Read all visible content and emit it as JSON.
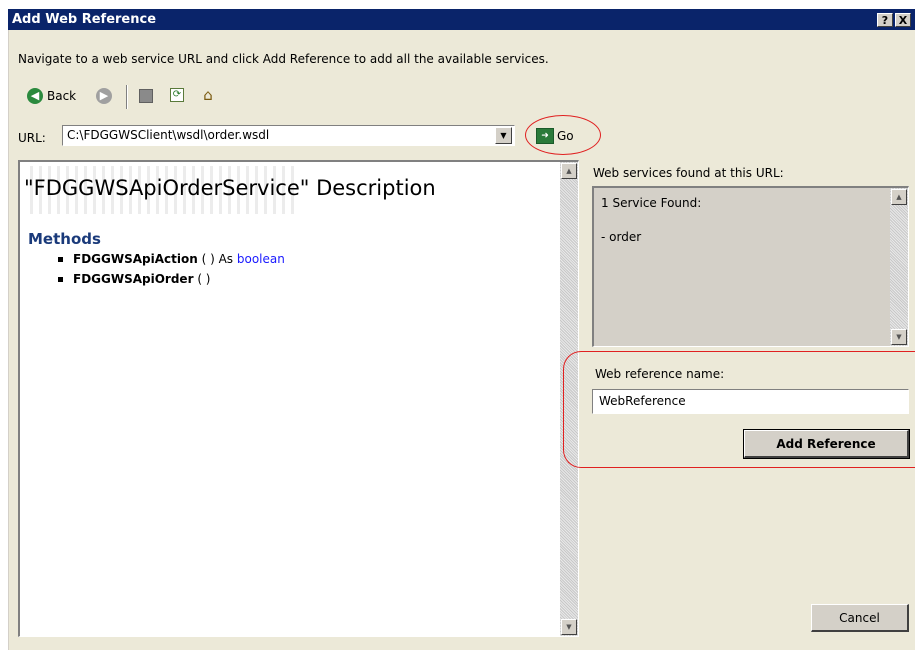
{
  "window": {
    "title": "Add Web Reference",
    "help_btn": "?",
    "close_btn": "X"
  },
  "instructions": "Navigate to a web service URL and click Add Reference to add all the available services.",
  "toolbar": {
    "back_label": "Back"
  },
  "url": {
    "label": "URL:",
    "value": "C:\\FDGGWSClient\\wsdl\\order.wsdl",
    "go_label": "Go"
  },
  "description": {
    "title": "\"FDGGWSApiOrderService\" Description",
    "methods_heading": "Methods",
    "methods": [
      {
        "name": "FDGGWSApiAction",
        "sig": " ( ) As ",
        "return_type": "boolean"
      },
      {
        "name": "FDGGWSApiOrder",
        "sig": " ( )",
        "return_type": ""
      }
    ]
  },
  "services": {
    "label": "Web services found at this URL:",
    "count_text": "1 Service Found:",
    "item": "- order"
  },
  "reference": {
    "label": "Web reference name:",
    "value": "WebReference",
    "add_button": "Add Reference"
  },
  "cancel_button": "Cancel",
  "colors": {
    "title_bar": "#0a246a",
    "dialog_bg": "#ece9d8",
    "highlight": "#e02020",
    "method_heading": "#1a3a7a",
    "link_type": "#1a1aff"
  }
}
